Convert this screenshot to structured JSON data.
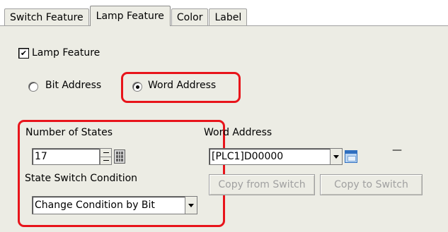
{
  "tabs": [
    {
      "label": "Switch Feature"
    },
    {
      "label": "Lamp Feature"
    },
    {
      "label": "Color"
    },
    {
      "label": "Label"
    }
  ],
  "lamp_feature": {
    "label": "Lamp Feature",
    "checked": true
  },
  "address_type": {
    "bit_label": "Bit Address",
    "word_label": "Word Address",
    "selected": "Word Address"
  },
  "states": {
    "label": "Number of States",
    "value": "17"
  },
  "switch_condition": {
    "label": "State Switch Condition",
    "value": "Change Condition by Bit"
  },
  "word_address": {
    "label": "Word Address",
    "value": "[PLC1]D00000",
    "side_text": "—"
  },
  "buttons": {
    "copy_from": "Copy from Switch",
    "copy_to": "Copy to Switch"
  },
  "colors": {
    "highlight": "#e8141b",
    "panel": "#ecece4"
  }
}
